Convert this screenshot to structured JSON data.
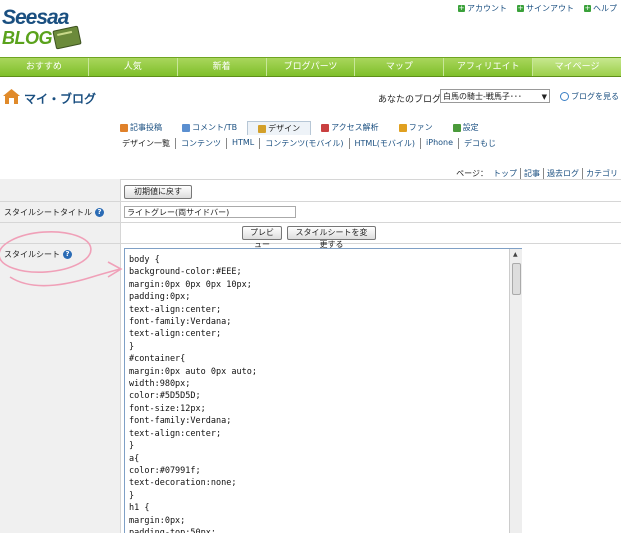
{
  "brand": {
    "line1": "Seesaa",
    "line2": "BLOG"
  },
  "toplinks": [
    "アカウント",
    "サインアウト",
    "ヘルプ"
  ],
  "globalnav": [
    "おすすめ",
    "人気",
    "新着",
    "ブログパーツ",
    "マップ",
    "アフィリエイト",
    "マイページ"
  ],
  "myblog": {
    "title": "マイ・ブログ",
    "yourblog_label": "あなたのブログ：",
    "selected_blog": "白馬の騎士-戦馬子･･･",
    "view_blog": "ブログを見る"
  },
  "tabs": [
    {
      "label": "記事投稿",
      "icon": "pencil-icon",
      "color": "#e0812a"
    },
    {
      "label": "コメント/TB",
      "icon": "comment-icon",
      "color": "#5b8fd0"
    },
    {
      "label": "デザイン",
      "icon": "design-icon",
      "color": "#d3a02a",
      "active": true
    },
    {
      "label": "アクセス解析",
      "icon": "chart-icon",
      "color": "#c94040"
    },
    {
      "label": "ファン",
      "icon": "fan-icon",
      "color": "#e0a020"
    },
    {
      "label": "設定",
      "icon": "settings-icon",
      "color": "#4a9a3a"
    }
  ],
  "sublinks": [
    "デザイン一覧",
    "コンテンツ",
    "HTML",
    "コンテンツ(モバイル)",
    "HTML(モバイル)",
    "iPhone",
    "デコもじ"
  ],
  "pagerow": {
    "label": "ページ：",
    "links": [
      "トップ",
      "記事",
      "過去ログ",
      "カテゴリ"
    ]
  },
  "form": {
    "reset_button": "初期値に戻す",
    "stylesheet_title_label": "スタイルシートタイトル",
    "stylesheet_title_value": "ライトグレー(両サイドバー)",
    "preview_button": "プレビュー",
    "change_button": "スタイルシートを変更する",
    "stylesheet_label": "スタイルシート",
    "stylesheet_code": "body {\nbackground-color:#EEE;\nmargin:0px 0px 0px 10px;\npadding:0px;\ntext-align:center;\nfont-family:Verdana;\ntext-align:center;\n}\n#container{\nmargin:0px auto 0px auto;\nwidth:980px;\ncolor:#5D5D5D;\nfont-size:12px;\nfont-family:Verdana;\ntext-align:center;\n}\na{\ncolor:#07991f;\ntext-decoration:none;\n}\nh1 {\nmargin:0px;\npadding-top:50px;"
  },
  "colors": {
    "accent_green": "#7fbf2a",
    "link_blue": "#1a4f80",
    "annotation_pink": "#f0a0b8"
  }
}
